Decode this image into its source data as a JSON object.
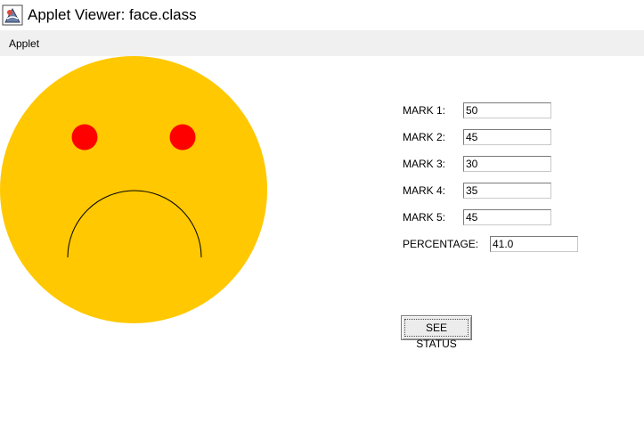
{
  "window": {
    "title": "Applet Viewer: face.class",
    "icon": "java-applet-icon"
  },
  "menu": {
    "items": [
      {
        "label": "Applet"
      }
    ]
  },
  "face": {
    "expression": "sad",
    "face_color": "#ffc800",
    "eye_color": "#ff0000",
    "mouth_color": "#000000"
  },
  "marks": [
    {
      "label": "MARK 1:",
      "value": "50"
    },
    {
      "label": "MARK 2:",
      "value": "45"
    },
    {
      "label": "MARK 3:",
      "value": "30"
    },
    {
      "label": "MARK 4:",
      "value": "35"
    },
    {
      "label": "MARK 5:",
      "value": "45"
    }
  ],
  "percentage": {
    "label": "PERCENTAGE:",
    "value": "41.0"
  },
  "status_button": {
    "label": "SEE STATUS"
  }
}
